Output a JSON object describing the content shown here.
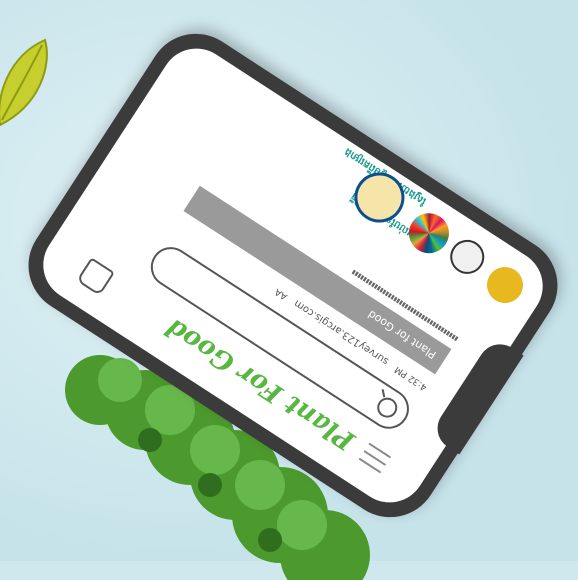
{
  "app": {
    "brand": "Plant For Good"
  },
  "search": {
    "placeholder": ""
  },
  "browser": {
    "time": "4:32 PM",
    "url": "survey123.arcgis.com",
    "aa": "AA"
  },
  "banner": {
    "title": "Plant for Good"
  },
  "links": {
    "line1": "ស្វែងយល់បន្ថែមអំពីកម្មវិធី",
    "line2": "ស្វែងយល់បន្ថែមពីគម្រោង"
  },
  "colors": {
    "brand_green": "#58b741",
    "teal": "#1a9a8d",
    "phone_frame": "#3b3b3b",
    "background": "#cfe8ee"
  }
}
